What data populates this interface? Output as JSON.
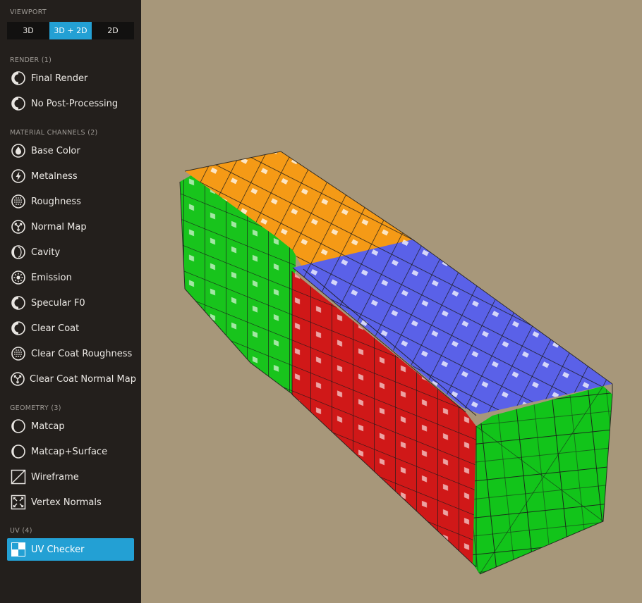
{
  "viewport_section": {
    "title": "VIEWPORT",
    "options": [
      "3D",
      "3D + 2D",
      "2D"
    ],
    "active": "3D + 2D"
  },
  "render_section": {
    "title": "RENDER (1)",
    "items": [
      {
        "label": "Final Render",
        "icon": "half-circle-icon"
      },
      {
        "label": "No Post-Processing",
        "icon": "half-circle-icon"
      }
    ]
  },
  "material_section": {
    "title": "MATERIAL CHANNELS (2)",
    "items": [
      {
        "label": "Base Color",
        "icon": "droplet-icon"
      },
      {
        "label": "Metalness",
        "icon": "lightning-icon"
      },
      {
        "label": "Roughness",
        "icon": "dotted-circle-icon"
      },
      {
        "label": "Normal Map",
        "icon": "normal-arrows-icon"
      },
      {
        "label": "Cavity",
        "icon": "cavity-icon"
      },
      {
        "label": "Emission",
        "icon": "sun-icon"
      },
      {
        "label": "Specular F0",
        "icon": "half-circle-icon"
      },
      {
        "label": "Clear Coat",
        "icon": "half-circle-icon"
      },
      {
        "label": "Clear Coat Roughness",
        "icon": "dotted-circle-icon"
      },
      {
        "label": "Clear Coat Normal Map",
        "icon": "normal-arrows-icon"
      }
    ]
  },
  "geometry_section": {
    "title": "GEOMETRY (3)",
    "items": [
      {
        "label": "Matcap",
        "icon": "matcap-icon"
      },
      {
        "label": "Matcap+Surface",
        "icon": "matcap-icon"
      },
      {
        "label": "Wireframe",
        "icon": "wireframe-icon"
      },
      {
        "label": "Vertex Normals",
        "icon": "vertex-normals-icon"
      }
    ]
  },
  "uv_section": {
    "title": "UV (4)",
    "items": [
      {
        "label": "UV Checker",
        "icon": "checker-icon",
        "active": true
      }
    ]
  },
  "scene": {
    "object": "uv-checker-box",
    "face_colors": {
      "top_end": "#f59a16",
      "top": "#5a61e8",
      "left_end": "#18c41c",
      "side": "#d01818",
      "front": "#12c41a"
    },
    "background": "#a7977a"
  }
}
